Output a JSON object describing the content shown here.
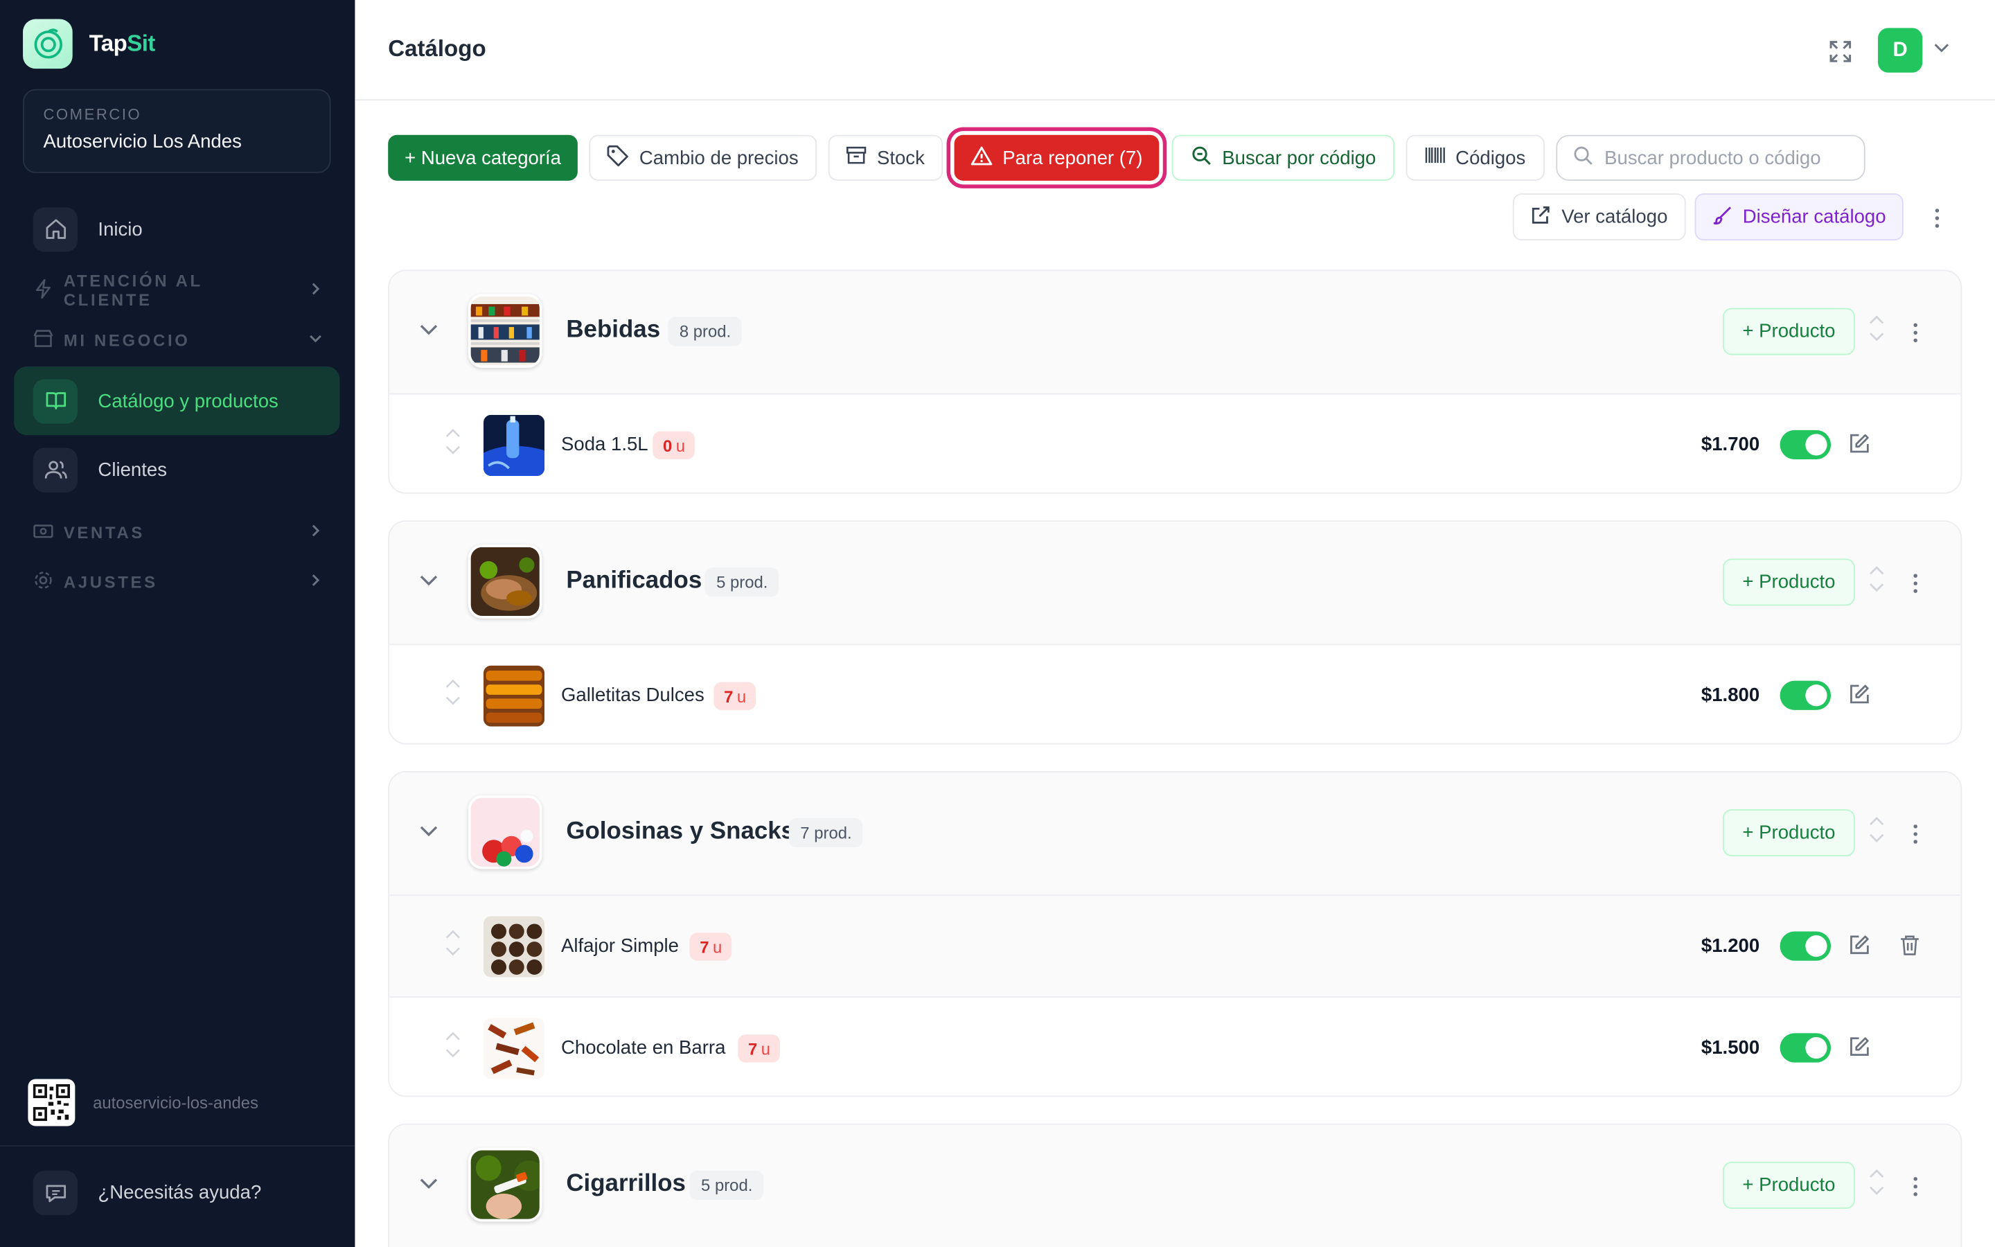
{
  "brand": {
    "name_prefix": "Tap",
    "name_highlight": "Sit"
  },
  "store": {
    "kicker": "COMERCIO",
    "name": "Autoservicio Los Andes"
  },
  "nav": {
    "inicio": "Inicio",
    "atencion": "ATENCIÓN AL CLIENTE",
    "mi_negocio": "MI NEGOCIO",
    "catalogo": "Catálogo y productos",
    "clientes": "Clientes",
    "ventas": "VENTAS",
    "ajustes": "AJUSTES"
  },
  "footer": {
    "slug": "autoservicio-los-andes",
    "help": "¿Necesitás ayuda?"
  },
  "header": {
    "title": "Catálogo",
    "avatar_initial": "D"
  },
  "toolbar": {
    "new_category": "+ Nueva categoría",
    "price_change": "Cambio de precios",
    "stock": "Stock",
    "restock": "Para reponer (7)",
    "search_by_code": "Buscar por código",
    "codes": "Códigos",
    "search_placeholder": "Buscar producto o código",
    "view_catalog": "Ver catálogo",
    "design_catalog": "Diseñar catálogo"
  },
  "colors": {
    "accent": "#15803d",
    "alert": "#dc2626",
    "sidebar_bg": "#0f172a",
    "toggle_on": "#22c55e"
  },
  "add_product_label": "+ Producto",
  "categories": [
    {
      "name": "Bebidas",
      "count": "8 prod.",
      "products": [
        {
          "name": "Soda 1.5L",
          "stock_num": "0",
          "stock_unit": "u",
          "price": "$1.700"
        }
      ]
    },
    {
      "name": "Panificados",
      "count": "5 prod.",
      "products": [
        {
          "name": "Galletitas Dulces",
          "stock_num": "7",
          "stock_unit": "u",
          "price": "$1.800"
        }
      ]
    },
    {
      "name": "Golosinas y Snacks",
      "count": "7 prod.",
      "products": [
        {
          "name": "Alfajor Simple",
          "stock_num": "7",
          "stock_unit": "u",
          "price": "$1.200"
        },
        {
          "name": "Chocolate en Barra",
          "stock_num": "7",
          "stock_unit": "u",
          "price": "$1.500"
        }
      ]
    },
    {
      "name": "Cigarrillos",
      "count": "5 prod.",
      "products": []
    }
  ]
}
